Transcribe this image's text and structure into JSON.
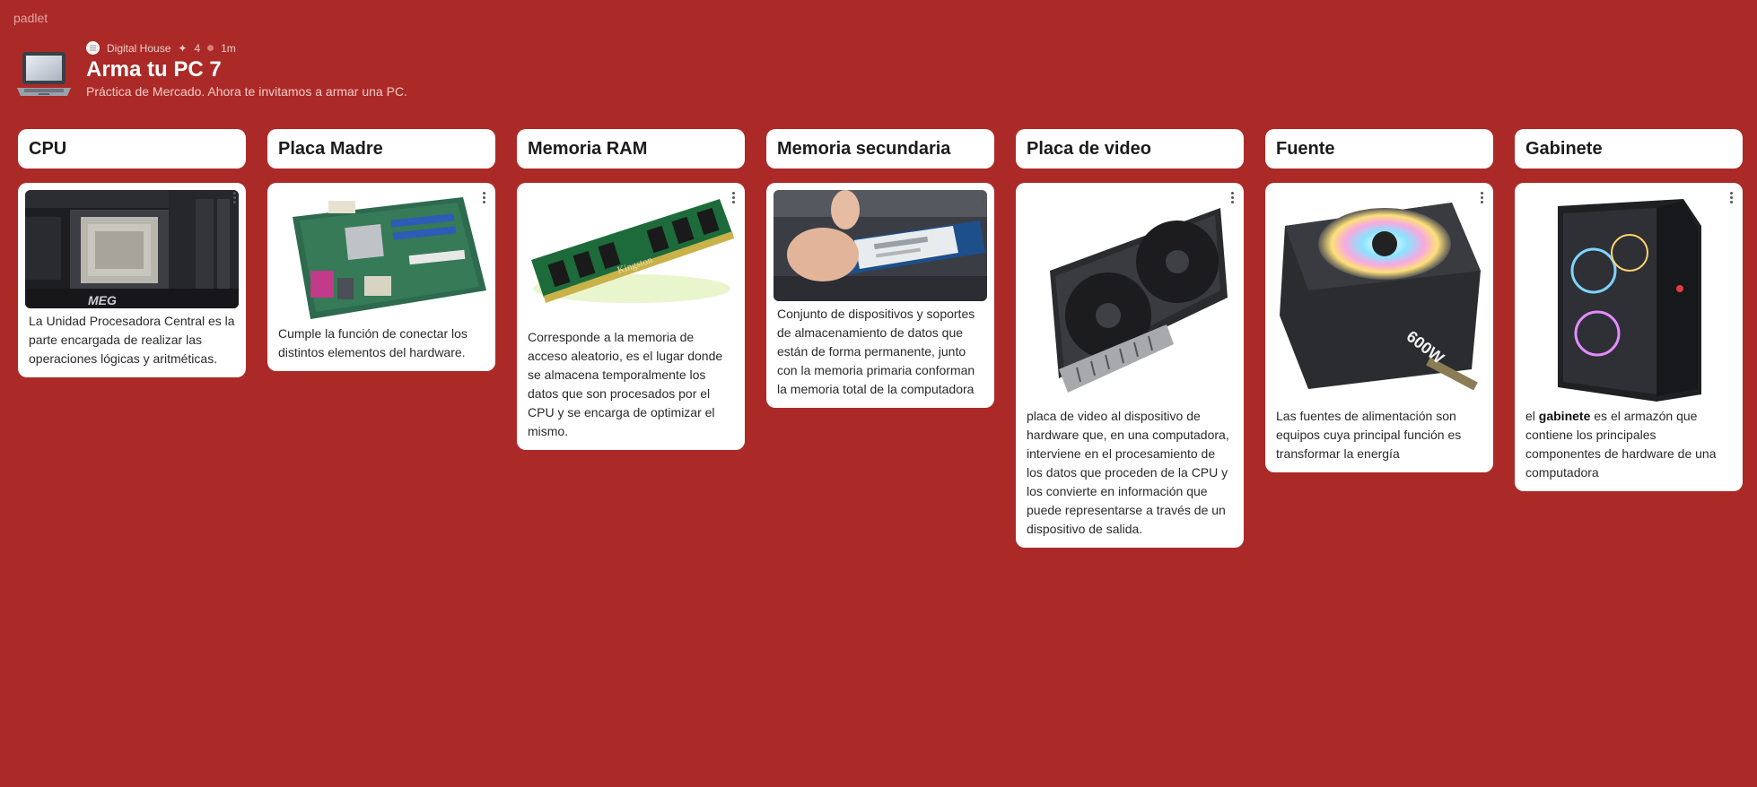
{
  "brand": "padlet",
  "header": {
    "author": "Digital House",
    "likes": "4",
    "time": "1m",
    "title": "Arma tu PC 7",
    "subtitle": "Práctica de Mercado. Ahora te invitamos a armar una PC."
  },
  "columns": [
    {
      "title": "CPU",
      "image": "motherboard-with-cpu-photo",
      "text": "La Unidad Procesadora Central es la parte encargada de realizar las operaciones lógicas y aritméticas."
    },
    {
      "title": "Placa Madre",
      "image": "motherboard-photo",
      "text": "Cumple la función de conectar los distintos elementos del hardware."
    },
    {
      "title": "Memoria RAM",
      "image": "ram-module-photo",
      "label": "Kingston",
      "text": "Corresponde a la memoria de acceso aleatorio, es el lugar donde se almacena temporalmente los datos que son procesados por el CPU y se encarga de optimizar el mismo."
    },
    {
      "title": "Memoria secundaria",
      "image": "ssd-m2-photo",
      "text": "Conjunto de dispositivos y soportes de almacenamiento de datos que están de forma permanente, junto con la memoria primaria conforman la memoria total de la computadora"
    },
    {
      "title": "Placa de video",
      "image": "graphics-card-photo",
      "text": "placa de video al dispositivo de hardware que, en una computadora, interviene en el procesamiento de los datos que proceden de la CPU y los convierte en información que puede representarse a través de un dispositivo de salida."
    },
    {
      "title": "Fuente",
      "image": "power-supply-photo",
      "label": "600W",
      "text": "Las fuentes de alimentación son equipos cuya principal función es transformar la energía"
    },
    {
      "title": "Gabinete",
      "image": "pc-case-photo",
      "text_before": "el ",
      "text_bold": "gabinete",
      "text_after": " es el armazón que contiene los principales componentes de hardware de una computadora"
    }
  ],
  "colors": {
    "background": "#ab2a27",
    "card": "#ffffff"
  }
}
